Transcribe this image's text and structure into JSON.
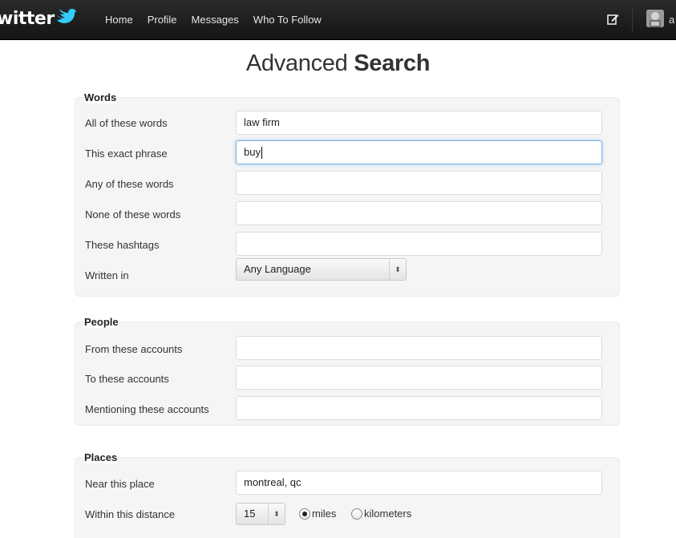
{
  "brand": {
    "logo_text": "witter"
  },
  "nav": {
    "home": "Home",
    "profile": "Profile",
    "messages": "Messages",
    "who_to_follow": "Who To Follow"
  },
  "user": {
    "initial": "a"
  },
  "page": {
    "title_light": "Advanced ",
    "title_bold": "Search"
  },
  "words": {
    "legend": "Words",
    "all_label": "All of these words",
    "all_value": "law firm",
    "exact_label": "This exact phrase",
    "exact_value": "buy",
    "any_label": "Any of these words",
    "any_value": "",
    "none_label": "None of these words",
    "none_value": "",
    "hashtags_label": "These hashtags",
    "hashtags_value": "",
    "language_label": "Written in",
    "language_value": "Any Language"
  },
  "people": {
    "legend": "People",
    "from_label": "From these accounts",
    "from_value": "",
    "to_label": "To these accounts",
    "to_value": "",
    "mention_label": "Mentioning these accounts",
    "mention_value": ""
  },
  "places": {
    "legend": "Places",
    "near_label": "Near this place",
    "near_value": "montreal, qc",
    "distance_label": "Within this distance",
    "distance_value": "15",
    "unit_miles": "miles",
    "unit_km": "kilometers",
    "selected_unit": "miles"
  },
  "icons": {
    "compose": "compose-tweet-icon",
    "bird": "twitter-bird-icon",
    "select_arrows": "updown-arrows-icon"
  },
  "colors": {
    "topbar": "#1a1a1a",
    "section_bg": "#f5f5f5",
    "focus": "#7fb1e1",
    "brand_blue": "#33ccff"
  }
}
